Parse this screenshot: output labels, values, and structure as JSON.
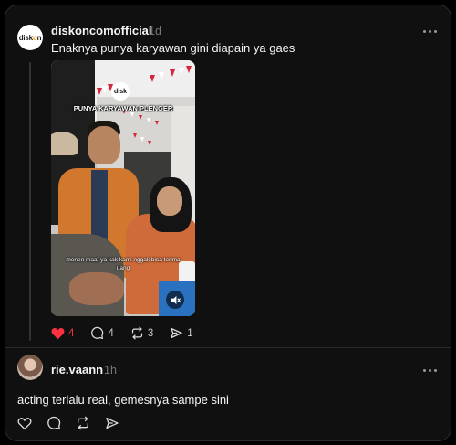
{
  "post": {
    "username": "diskoncomofficial",
    "avatar_text_a": "disk",
    "avatar_text_b": "n",
    "timestamp": "1d",
    "caption": "Enaknya punya karyawan gini diapain ya gaes",
    "video": {
      "logo_text": "disk",
      "title_text": "PUNYA KARYAWAN PLENGER",
      "subtitle_text": "menen maaf ya kak kami nggak bisa terima uang"
    },
    "likes": "4",
    "replies": "4",
    "reposts": "3",
    "shares": "1",
    "liked": true
  },
  "reply": {
    "username": "rie.vaann",
    "timestamp": "1h",
    "text": "acting terlalu real, gemesnya sampe sini"
  },
  "colors": {
    "like_active": "#ff3040",
    "background": "#101010",
    "text": "#f3f5f7",
    "muted": "#777777"
  }
}
